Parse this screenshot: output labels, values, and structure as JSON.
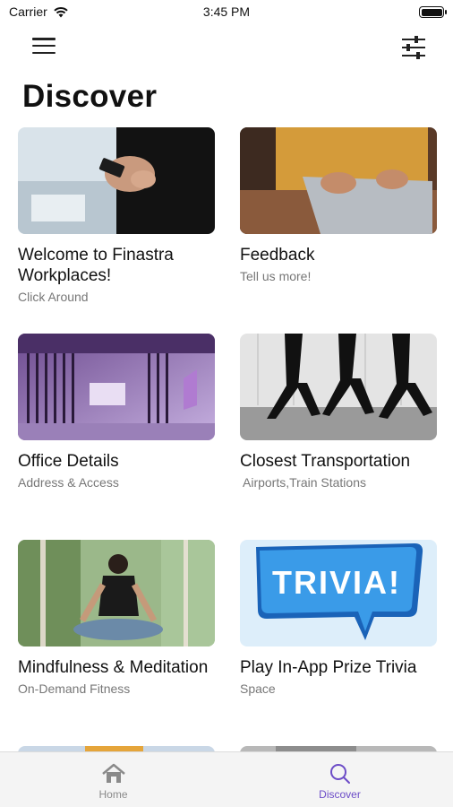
{
  "status_bar": {
    "carrier": "Carrier",
    "time": "3:45 PM"
  },
  "header": {
    "menu_icon": "hamburger-menu-icon",
    "filter_icon": "sliders-filter-icon"
  },
  "page": {
    "title": "Discover"
  },
  "cards": [
    {
      "title": "Welcome to Finastra Workplaces!",
      "subtitle": "Click Around",
      "image": "hands-holding-phone-photo"
    },
    {
      "title": "Feedback",
      "subtitle": "Tell us more!",
      "image": "person-typing-laptop-photo"
    },
    {
      "title": "Office Details",
      "subtitle": "Address & Access",
      "image": "office-lobby-photo"
    },
    {
      "title": "Closest Transportation",
      "subtitle": "Airports,Train Stations",
      "image": "commuters-walking-photo"
    },
    {
      "title": "Mindfulness & Meditation",
      "subtitle": "On-Demand Fitness",
      "image": "meditation-forest-photo"
    },
    {
      "title": "Play In-App Prize Trivia",
      "subtitle": "Space",
      "image": "trivia-speech-bubble",
      "image_text": "TRIVIA!"
    }
  ],
  "tab_bar": {
    "tabs": [
      {
        "label": "Home",
        "icon": "home-icon",
        "active": false
      },
      {
        "label": "Discover",
        "icon": "search-icon",
        "active": true
      }
    ]
  },
  "colors": {
    "accent": "#6c4cc7",
    "inactive": "#8a8a8a",
    "trivia_bubble": "#2f8de4"
  }
}
